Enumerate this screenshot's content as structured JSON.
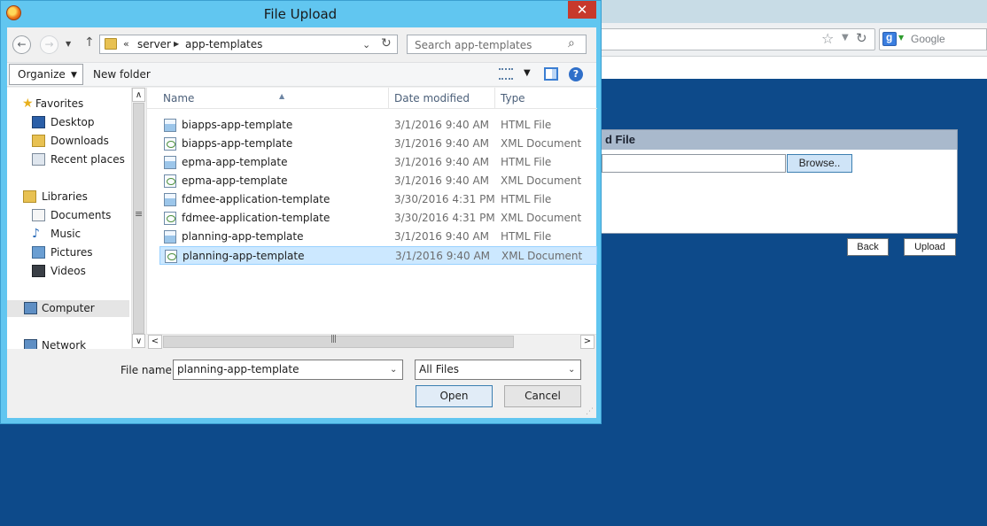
{
  "browser": {
    "search_placeholder": "Google",
    "page": {
      "panel_title": "d File",
      "browse_label": "Browse..",
      "back_label": "Back",
      "upload_label": "Upload"
    }
  },
  "dialog": {
    "title": "File Upload",
    "close_label": "✕",
    "nav": {
      "back_label": "←",
      "forward_label": "→",
      "up_label": "↑",
      "overflow_label": "«",
      "breadcrumb": [
        "server",
        "app-templates"
      ],
      "search_placeholder": "Search app-templates"
    },
    "toolbar": {
      "organize_label": "Organize",
      "new_folder_label": "New folder",
      "help_label": "?"
    },
    "navpane": {
      "favorites": {
        "label": "Favorites",
        "items": [
          "Desktop",
          "Downloads",
          "Recent places"
        ]
      },
      "libraries": {
        "label": "Libraries",
        "items": [
          "Documents",
          "Music",
          "Pictures",
          "Videos"
        ]
      },
      "computer": "Computer",
      "network": "Network"
    },
    "columns": {
      "name": "Name",
      "date": "Date modified",
      "type": "Type"
    },
    "files": [
      {
        "name": "biapps-app-template",
        "date": "3/1/2016 9:40 AM",
        "type": "HTML File",
        "icon": "html"
      },
      {
        "name": "biapps-app-template",
        "date": "3/1/2016 9:40 AM",
        "type": "XML Document",
        "icon": "xml"
      },
      {
        "name": "epma-app-template",
        "date": "3/1/2016 9:40 AM",
        "type": "HTML File",
        "icon": "html"
      },
      {
        "name": "epma-app-template",
        "date": "3/1/2016 9:40 AM",
        "type": "XML Document",
        "icon": "xml"
      },
      {
        "name": "fdmee-application-template",
        "date": "3/30/2016 4:31 PM",
        "type": "HTML File",
        "icon": "html"
      },
      {
        "name": "fdmee-application-template",
        "date": "3/30/2016 4:31 PM",
        "type": "XML Document",
        "icon": "xml"
      },
      {
        "name": "planning-app-template",
        "date": "3/1/2016 9:40 AM",
        "type": "HTML File",
        "icon": "html"
      },
      {
        "name": "planning-app-template",
        "date": "3/1/2016 9:40 AM",
        "type": "XML Document",
        "icon": "xml",
        "selected": true
      }
    ],
    "filename_label": "File name:",
    "filename_value": "planning-app-template",
    "filter_value": "All Files",
    "open_label": "Open",
    "cancel_label": "Cancel"
  },
  "colors": {
    "title_bar": "#61c6f0",
    "page_background": "#0d4a8a",
    "selection": "#cce8ff",
    "close_button": "#c7392c"
  }
}
